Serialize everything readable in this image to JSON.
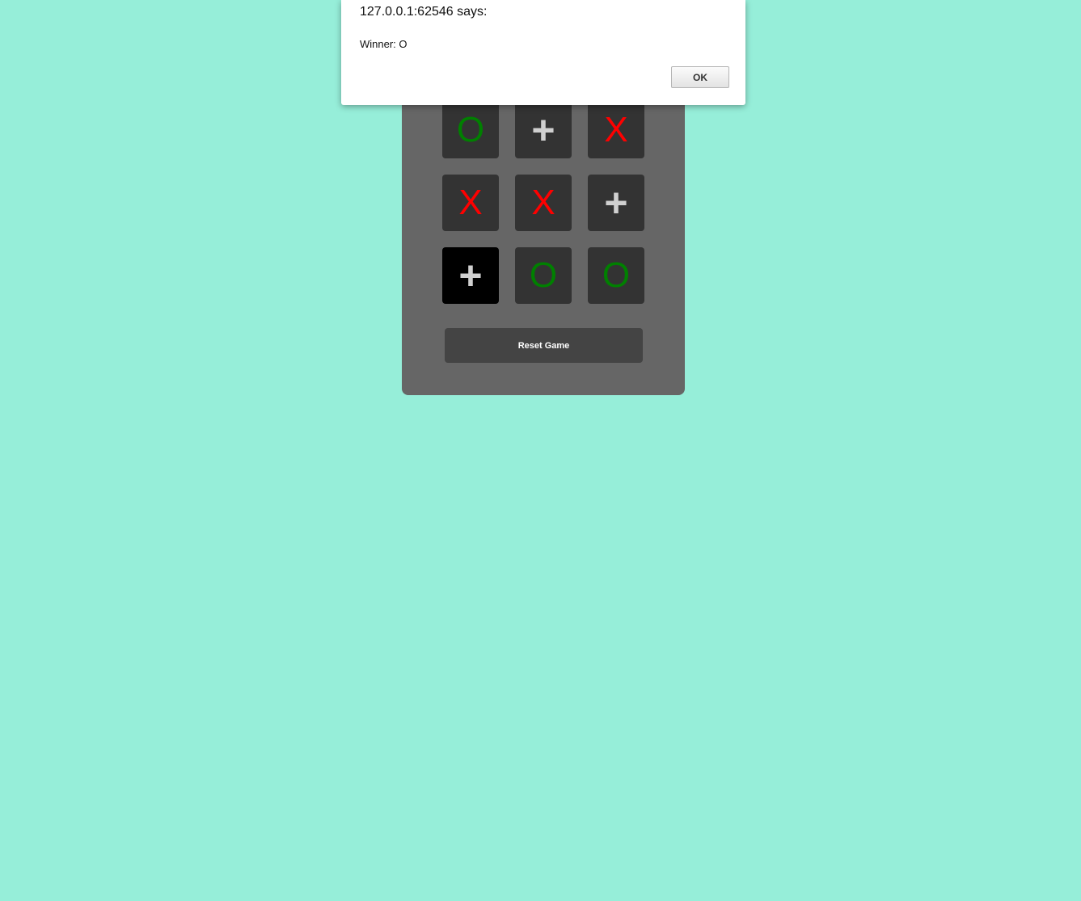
{
  "alert": {
    "title": "127.0.0.1:62546 says:",
    "message": "Winner: O",
    "ok_label": "OK"
  },
  "game": {
    "board": [
      [
        "O",
        "+",
        "X"
      ],
      [
        "X",
        "X",
        "+"
      ],
      [
        "+",
        "O",
        "O"
      ]
    ],
    "reset_label": "Reset Game"
  },
  "colors": {
    "page_background": "#96eed9",
    "panel": "#666666",
    "cell": "#333333",
    "cell_hover": "#000000",
    "x_mark": "#ff0000",
    "o_mark": "#008000",
    "empty_mark": "#d0d0d0",
    "button": "#444444"
  },
  "icons": {
    "empty_cell": "plus-icon"
  }
}
